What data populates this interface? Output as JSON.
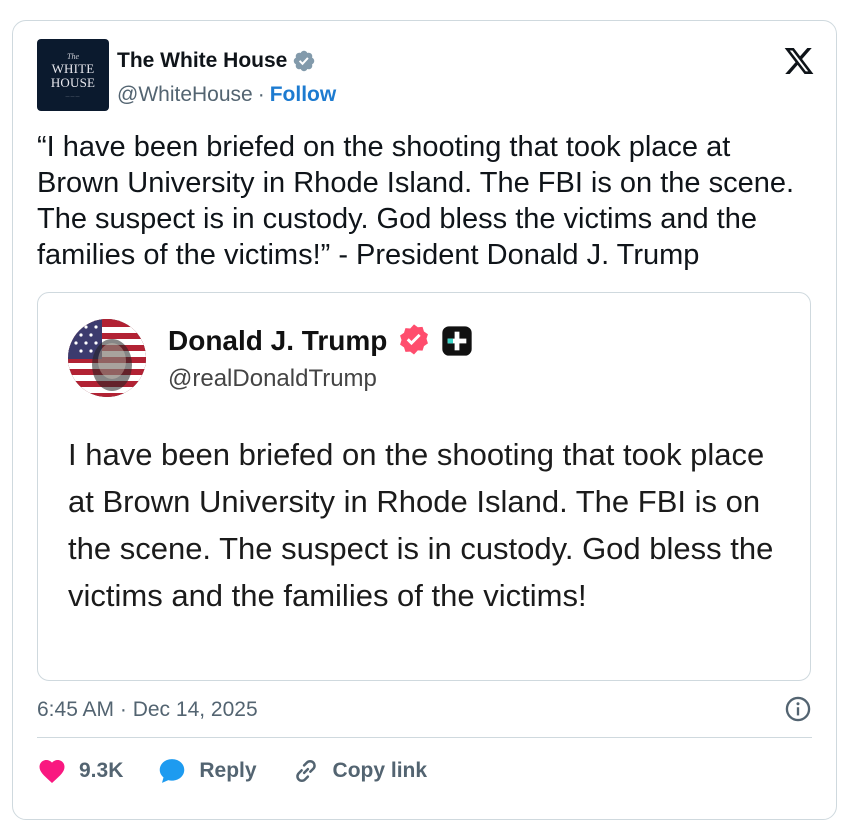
{
  "header": {
    "avatar_line1": "The",
    "avatar_line2": "WHITE",
    "avatar_line3": "HOUSE",
    "display_name": "The White House",
    "handle": "@WhiteHouse",
    "separator": "·",
    "follow_label": "Follow"
  },
  "tweet": {
    "text": "“I have been briefed on the shooting that took place at Brown University in Rhode Island. The FBI is on the scene. The suspect is in custody. God bless the victims and the families of the victims!” - President Donald J. Trump"
  },
  "quote": {
    "display_name": "Donald J. Trump",
    "handle": "@realDonaldTrump",
    "text": "I have been briefed on the shooting that took place at Brown University in Rhode Island. The FBI is on the scene. The suspect is in custody. God bless the victims and the families of the victims!"
  },
  "meta": {
    "timestamp": "6:45 AM · Dec 14, 2025"
  },
  "actions": {
    "like_count": "9.3K",
    "reply_label": "Reply",
    "copy_link_label": "Copy link"
  },
  "colors": {
    "link": "#1d7bd0",
    "verified_blue": "#829aab",
    "like_red": "#f91880",
    "reply_blue": "#1d9bf0",
    "truth_badge": "#ff4d6d"
  }
}
